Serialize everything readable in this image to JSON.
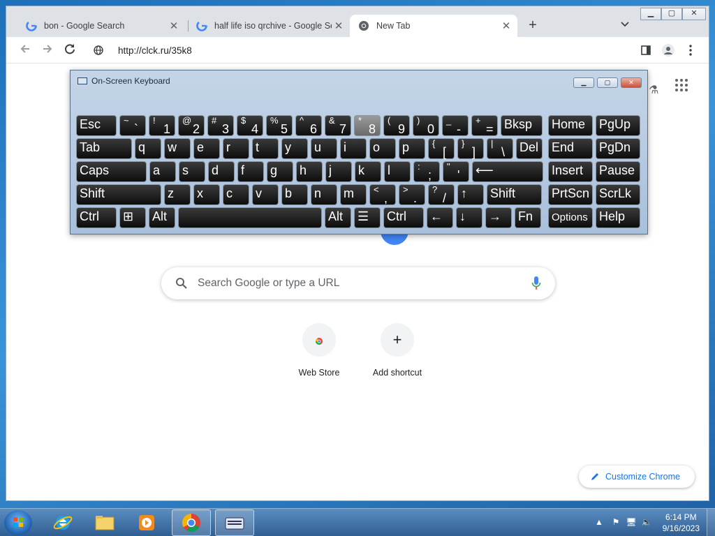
{
  "browser": {
    "tabs": [
      {
        "title": "bon - Google Search",
        "icon": "google-icon"
      },
      {
        "title": "half life iso qrchive - Google Search",
        "icon": "google-icon"
      },
      {
        "title": "New Tab",
        "icon": "chrome-icon"
      }
    ],
    "address": "http://clck.ru/35k8",
    "new_tab_symbol": "+",
    "tab_close_symbol": "✕"
  },
  "ntp": {
    "search_placeholder": "Search Google or type a URL",
    "shortcuts": [
      {
        "label": "Web Store",
        "icon": "web-store-icon"
      },
      {
        "label": "Add shortcut",
        "icon": "plus-icon",
        "symbol": "+"
      }
    ],
    "customize_label": "Customize Chrome"
  },
  "osk": {
    "title": "On-Screen Keyboard",
    "rows": [
      [
        [
          "Esc"
        ],
        [
          "~",
          "`"
        ],
        [
          "!",
          "1"
        ],
        [
          "@",
          "2"
        ],
        [
          "#",
          "3"
        ],
        [
          "$",
          "4"
        ],
        [
          "%",
          "5"
        ],
        [
          "^",
          "6"
        ],
        [
          "&",
          "7"
        ],
        [
          "*",
          "8"
        ],
        [
          "(",
          "9"
        ],
        [
          ")",
          "0"
        ],
        [
          "_",
          "-"
        ],
        [
          "+",
          "="
        ],
        [
          "Bksp"
        ],
        [
          "Home"
        ],
        [
          "PgUp"
        ]
      ],
      [
        [
          "Tab"
        ],
        [
          "q"
        ],
        [
          "w"
        ],
        [
          "e"
        ],
        [
          "r"
        ],
        [
          "t"
        ],
        [
          "y"
        ],
        [
          "u"
        ],
        [
          "i"
        ],
        [
          "o"
        ],
        [
          "p"
        ],
        [
          "{",
          "["
        ],
        [
          "}",
          "]"
        ],
        [
          "|",
          "\\"
        ],
        [
          "Del"
        ],
        [
          "End"
        ],
        [
          "PgDn"
        ]
      ],
      [
        [
          "Caps"
        ],
        [
          "a"
        ],
        [
          "s"
        ],
        [
          "d"
        ],
        [
          "f"
        ],
        [
          "g"
        ],
        [
          "h"
        ],
        [
          "j"
        ],
        [
          "k"
        ],
        [
          "l"
        ],
        [
          ":",
          ";"
        ],
        [
          "\"",
          "'"
        ],
        [
          "⟵"
        ],
        [
          "Insert"
        ],
        [
          "Pause"
        ]
      ],
      [
        [
          "Shift"
        ],
        [
          "z"
        ],
        [
          "x"
        ],
        [
          "c"
        ],
        [
          "v"
        ],
        [
          "b"
        ],
        [
          "n"
        ],
        [
          "m"
        ],
        [
          "<",
          ","
        ],
        [
          ">",
          "."
        ],
        [
          "?",
          "/"
        ],
        [
          "↑"
        ],
        [
          "Shift"
        ],
        [
          "PrtScn"
        ],
        [
          "ScrLk"
        ]
      ],
      [
        [
          "Ctrl"
        ],
        [
          "⊞"
        ],
        [
          "Alt"
        ],
        [
          ""
        ],
        [
          "Alt"
        ],
        [
          "☰"
        ],
        [
          "Ctrl"
        ],
        [
          "←"
        ],
        [
          "↓"
        ],
        [
          "→"
        ],
        [
          "Fn"
        ],
        [
          "Options"
        ],
        [
          "Help"
        ]
      ]
    ]
  },
  "taskbar": {
    "time": "6:14 PM",
    "date": "9/16/2023"
  }
}
